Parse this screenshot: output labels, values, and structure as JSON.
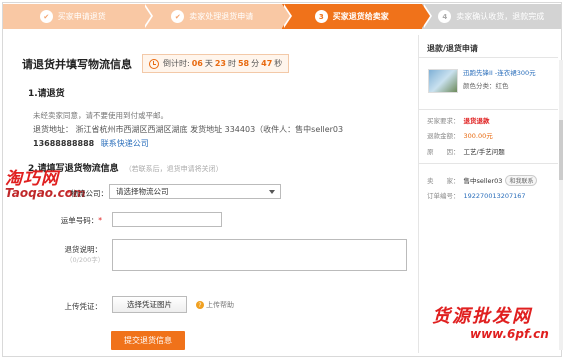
{
  "steps": [
    {
      "num": "✔",
      "label": "买家申请退货",
      "state": "done"
    },
    {
      "num": "✔",
      "label": "卖家处理退货申请",
      "state": "done"
    },
    {
      "num": "3",
      "label": "买家退货给卖家",
      "state": "active"
    },
    {
      "num": "4",
      "label": "卖家确认收货，退款完成",
      "state": "todo"
    }
  ],
  "main": {
    "title": "请退货并填写物流信息",
    "countdown": {
      "prefix": "倒计时:",
      "days": "06",
      "d_unit": "天",
      "hours": "23",
      "h_unit": "时",
      "minutes": "58",
      "m_unit": "分",
      "seconds": "47",
      "s_unit": "秒"
    },
    "section1": "1.请退货",
    "notice": "未经卖家同意，请不要使用到付或平邮。",
    "address": "退货地址：  浙江省杭州市西湖区西湖区湖底 发货地址 334403（收件人：售中seller03",
    "phone": "13688888888",
    "contact_link": "联系快递公司",
    "section2": "2.请填写退货物流信息",
    "section2_hint": "（若联系后，退货申请将关闭）",
    "watermark": "淘巧网",
    "watermark_url": "Taoqao.com"
  },
  "form": {
    "logistics_label": "物流公司：",
    "logistics_value": "请选择物流公司",
    "tracking_label": "运单号码：",
    "note_label": "退货说明：",
    "note_hint": "（0/200字）",
    "upload_label": "上传凭证：",
    "upload_button": "选择凭证图片",
    "help": "上传帮助",
    "submit": "提交退货信息"
  },
  "side": {
    "title": "退款/退货申请",
    "product_name": "迅跑先锋II -连衣裙300元",
    "product_color": "颜色分类：红色",
    "rows": [
      {
        "k": "买家要求：",
        "v": "退货退款",
        "style": "red"
      },
      {
        "k": "退款金额：",
        "v": "300.00元",
        "style": "orange"
      },
      {
        "k": "原　　因：",
        "v": "工艺/手艺问题",
        "style": ""
      },
      {
        "k": "卖　　家：",
        "v": "售中seller03",
        "style": "",
        "ww": "和我联系"
      },
      {
        "k": "订单编号：",
        "v": "192270013207167",
        "style": "blue"
      }
    ]
  },
  "brand": {
    "name": "货源批发网",
    "url": "www.6pf.cn"
  },
  "colors": {
    "accent": "#f0721a",
    "done": "#f9c8a4",
    "todo": "#d3d3d3",
    "link": "#2a6ebb",
    "red": "#e02020"
  }
}
